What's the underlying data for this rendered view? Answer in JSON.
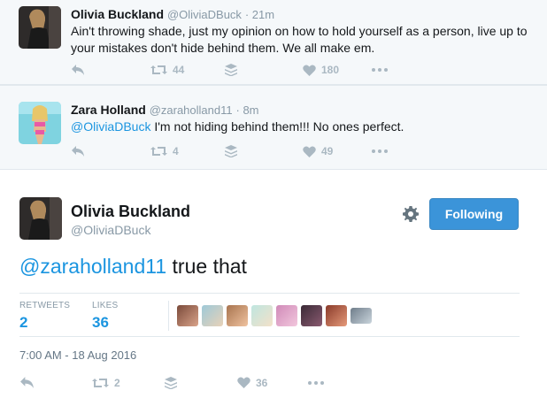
{
  "replies": [
    {
      "name": "Olivia Buckland",
      "handle": "@OliviaDBuck",
      "time": "· 21m",
      "text": "Ain't throwing shade, just my opinion on how to hold yourself as a person, live up to your mistakes don't hide behind them. We all make em.",
      "retweets": "44",
      "likes": "180"
    },
    {
      "name": "Zara Holland",
      "handle": "@zaraholland11",
      "time": "· 8m",
      "mention": "@OliviaDBuck",
      "text": " I'm not hiding behind them!!! No ones perfect.",
      "retweets": "4",
      "likes": "49"
    }
  ],
  "main_tweet": {
    "name": "Olivia Buckland",
    "handle": "@OliviaDBuck",
    "follow_label": "Following",
    "mention": "@zaraholland11",
    "text": " true that",
    "retweets_label": "RETWEETS",
    "retweets_count": "2",
    "likes_label": "LIKES",
    "likes_count": "36",
    "timestamp": "7:00 AM - 18 Aug 2016",
    "action_retweets": "2",
    "action_likes": "36"
  },
  "icons": [
    "reply-icon",
    "retweet-icon",
    "buffer-icon",
    "heart-icon",
    "more-icon",
    "gear-icon"
  ],
  "colors": {
    "link": "#1b95e0",
    "follow_button": "#3b94d9",
    "muted": "#8899a6",
    "icon": "#aab8c2",
    "reply_bg": "#f5f8fa"
  }
}
